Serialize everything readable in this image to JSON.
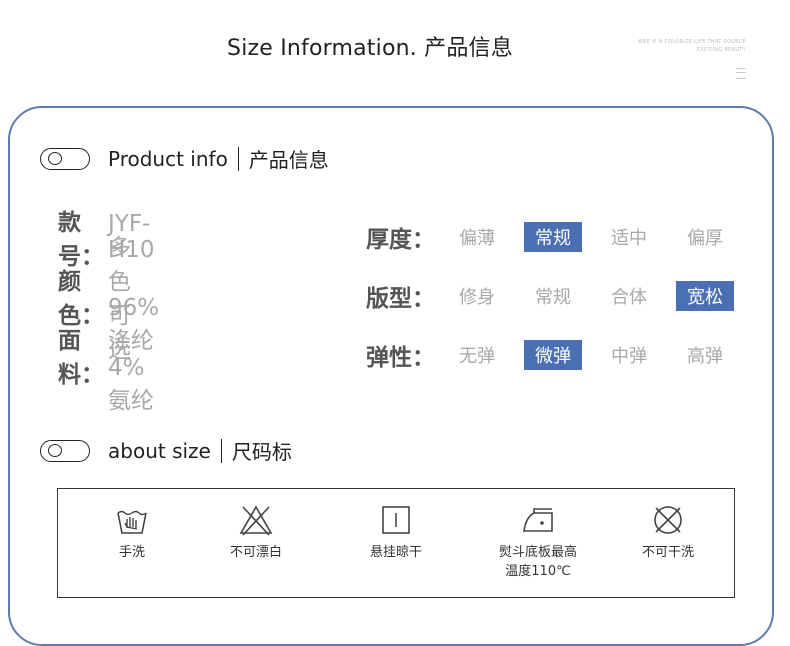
{
  "header": {
    "title": "Size Information.  产品信息",
    "note_line1": "WEE IF A COLORIZE LIFE THAT SOURCE",
    "note_line2": "EXCITING BEAUTY"
  },
  "product_section": {
    "title_en": "Product  info",
    "title_cn": "产品信息"
  },
  "info": [
    {
      "key": "款号：",
      "value": "JYF-H10"
    },
    {
      "key": "颜色：",
      "value": "多色可选"
    },
    {
      "key": "面料：",
      "value": "96%涤纶4%氨纶"
    }
  ],
  "options": [
    {
      "key": "厚度：",
      "choices": [
        "偏薄",
        "常规",
        "适中",
        "偏厚"
      ],
      "selected": 1
    },
    {
      "key": "版型：",
      "choices": [
        "修身",
        "常规",
        "合体",
        "宽松"
      ],
      "selected": 3
    },
    {
      "key": "弹性：",
      "choices": [
        "无弹",
        "微弹",
        "中弹",
        "高弹"
      ],
      "selected": 1
    }
  ],
  "size_section": {
    "title_en": "about size",
    "title_cn": "尺码标"
  },
  "care": [
    {
      "icon": "hand-wash-icon",
      "label": "手洗"
    },
    {
      "icon": "no-bleach-icon",
      "label": "不可漂白"
    },
    {
      "icon": "hang-dry-icon",
      "label": "悬挂晾干"
    },
    {
      "icon": "iron-icon",
      "label": "熨斗底板最高",
      "label2": "温度110℃"
    },
    {
      "icon": "no-dry-clean-icon",
      "label": "不可干洗"
    }
  ],
  "colors": {
    "accent": "#4a6fb2",
    "card_border": "#5f7bb0"
  }
}
